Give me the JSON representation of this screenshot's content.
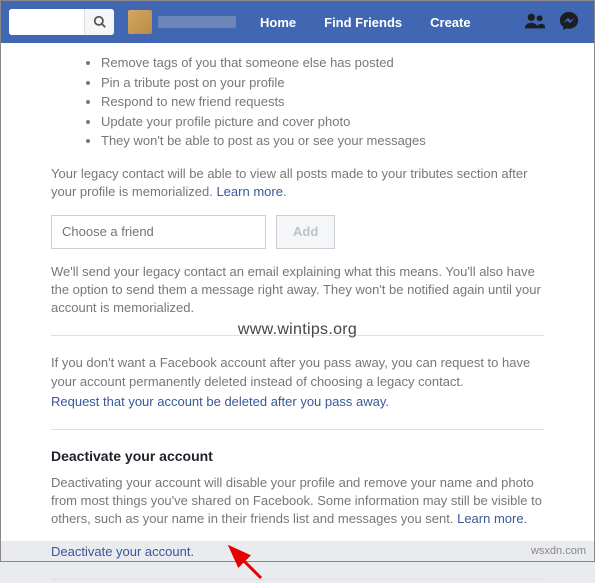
{
  "header": {
    "nav": {
      "home": "Home",
      "find_friends": "Find Friends",
      "create": "Create"
    }
  },
  "search": {
    "placeholder": ""
  },
  "legacy": {
    "bullets": [
      "Remove tags of you that someone else has posted",
      "Pin a tribute post on your profile",
      "Respond to new friend requests",
      "Update your profile picture and cover photo",
      "They won't be able to post as you or see your messages"
    ],
    "tributes_text": "Your legacy contact will be able to view all posts made to your tributes section after your profile is memorialized. ",
    "learn_more": "Learn more",
    "friend_placeholder": "Choose a friend",
    "add_label": "Add",
    "email_text": "We'll send your legacy contact an email explaining what this means. You'll also have the option to send them a message right away. They won't be notified again until your account is memorialized.",
    "delete_text": "If you don't want a Facebook account after you pass away, you can request to have your account permanently deleted instead of choosing a legacy contact.",
    "request_delete_link": "Request that your account be deleted after you pass away."
  },
  "deactivate": {
    "heading": "Deactivate your account",
    "text": "Deactivating your account will disable your profile and remove your name and photo from most things you've shared on Facebook. Some information may still be visible to others, such as your name in their friends list and messages you sent. ",
    "learn_more": "Learn more",
    "action_link": "Deactivate your account."
  },
  "watermark": "www.wintips.org",
  "footer": "wsxdn.com"
}
